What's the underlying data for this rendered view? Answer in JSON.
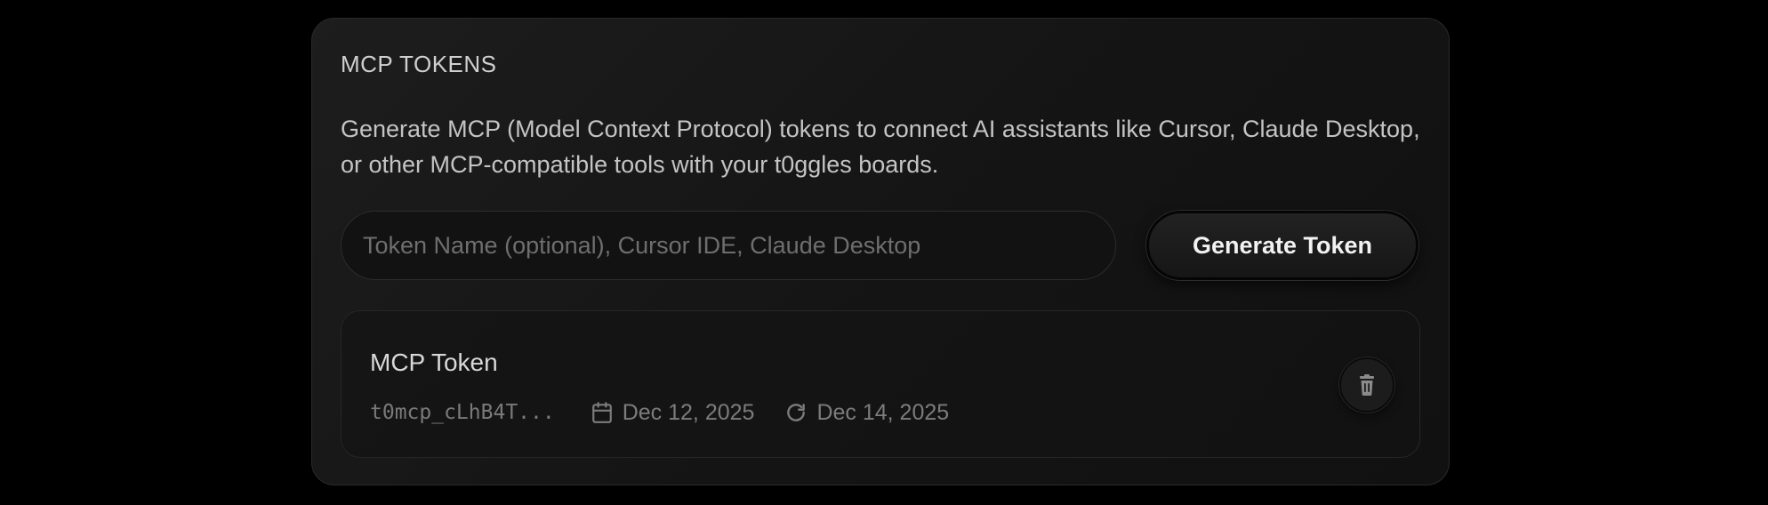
{
  "section": {
    "title": "MCP TOKENS",
    "description": "Generate MCP (Model Context Protocol) tokens to connect AI assistants like Cursor, Claude Desktop, or other MCP-compatible tools with your t0ggles boards."
  },
  "form": {
    "token_name_value": "",
    "token_name_placeholder": "Token Name (optional), Cursor IDE, Claude Desktop",
    "generate_label": "Generate Token"
  },
  "tokens": [
    {
      "name": "MCP Token",
      "prefix": "t0mcp_cLhB4T...",
      "created_icon": "calendar-icon",
      "created_date": "Dec 12, 2025",
      "last_used_icon": "refresh-icon",
      "last_used_date": "Dec 14, 2025",
      "delete_icon": "trash-icon"
    }
  ],
  "colors": {
    "page_background": "#000000",
    "card_background": "#171717",
    "text_primary": "#d8d8d8",
    "text_muted": "#7c7c7c"
  }
}
